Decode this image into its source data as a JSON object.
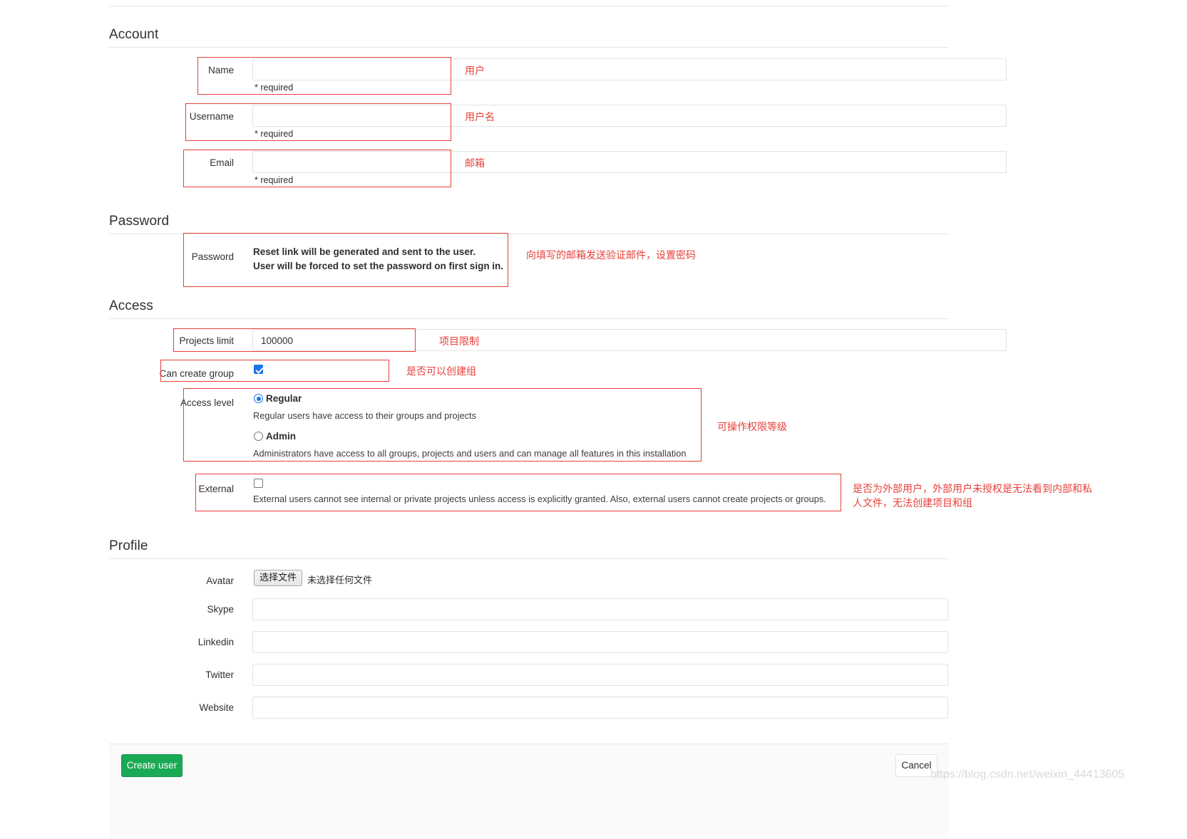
{
  "sections": {
    "account": {
      "title": "Account",
      "name": {
        "label": "Name",
        "value": "",
        "required_note": "* required",
        "annotation": "用户"
      },
      "username": {
        "label": "Username",
        "value": "",
        "required_note": "* required",
        "annotation": "用户名"
      },
      "email": {
        "label": "Email",
        "value": "",
        "required_note": "* required",
        "annotation": "邮箱"
      }
    },
    "password": {
      "title": "Password",
      "label": "Password",
      "line1": "Reset link will be generated and sent to the user.",
      "line2": "User will be forced to set the password on first sign in.",
      "annotation": "向填写的邮箱发送验证邮件，设置密码"
    },
    "access": {
      "title": "Access",
      "projects_limit": {
        "label": "Projects limit",
        "value": "100000",
        "annotation": "项目限制"
      },
      "can_create_group": {
        "label": "Can create group",
        "checked": true,
        "annotation": "是否可以创建组"
      },
      "access_level": {
        "label": "Access level",
        "annotation": "可操作权限等级",
        "options": [
          {
            "label": "Regular",
            "desc": "Regular users have access to their groups and projects",
            "selected": true
          },
          {
            "label": "Admin",
            "desc": "Administrators have access to all groups, projects and users and can manage all features in this installation",
            "selected": false
          }
        ]
      },
      "external": {
        "label": "External",
        "checked": false,
        "desc": "External users cannot see internal or private projects unless access is explicitly granted. Also, external users cannot create projects or groups.",
        "annotation_line1": "是否为外部用户，外部用户未授权是无法看到内部和私",
        "annotation_line2": "人文件，无法创建项目和组"
      }
    },
    "profile": {
      "title": "Profile",
      "avatar": {
        "label": "Avatar",
        "button_label": "选择文件",
        "file_status": "未选择任何文件"
      },
      "skype": {
        "label": "Skype",
        "value": ""
      },
      "linkedin": {
        "label": "Linkedin",
        "value": ""
      },
      "twitter": {
        "label": "Twitter",
        "value": ""
      },
      "website": {
        "label": "Website",
        "value": ""
      }
    }
  },
  "footer": {
    "create_label": "Create user",
    "cancel_label": "Cancel"
  },
  "watermark": "https://blog.csdn.net/weixin_44413605",
  "colors": {
    "annotation_red": "#e8403a",
    "primary_green": "#1aaa55",
    "accent_blue": "#1a73e8"
  }
}
